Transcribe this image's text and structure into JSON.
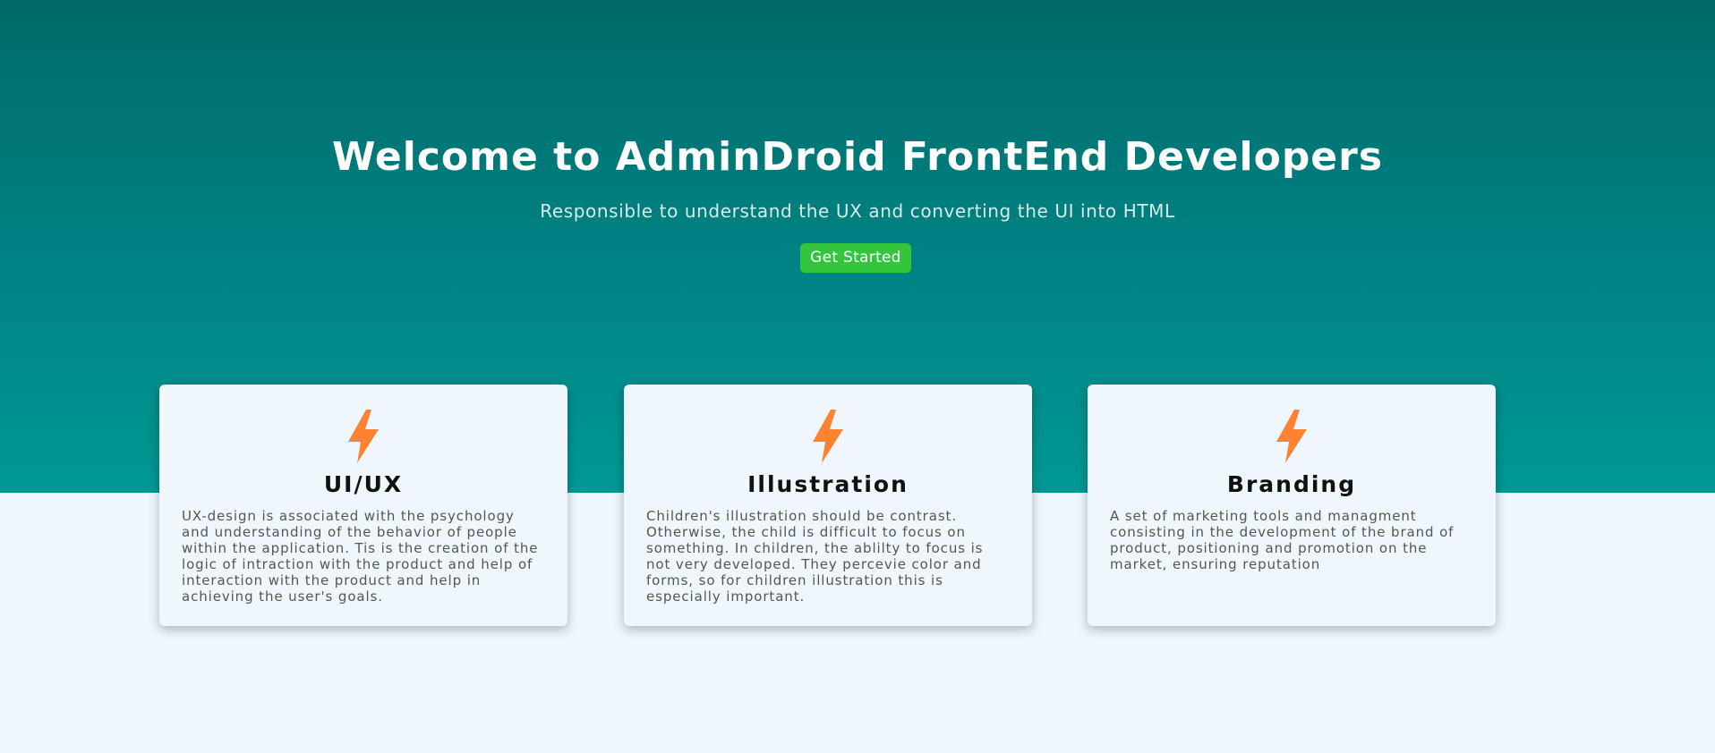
{
  "hero": {
    "title": "Welcome to AdminDroid FrontEnd Developers",
    "subtitle": "Responsible to understand the UX and converting the UI into HTML",
    "cta_label": "Get Started"
  },
  "cards": [
    {
      "icon": "lightning-bolt-icon",
      "title": "UI/UX",
      "text": "UX-design is associated with the psychology and understanding of the behavior of people within the application. Tis is the creation of the logic of intraction with the product and help of interaction with the product and help in achieving the user's goals."
    },
    {
      "icon": "lightning-bolt-icon",
      "title": "Illustration",
      "text": "Children's illustration should be contrast. Otherwise, the child is difficult to focus on something. In children, the ablilty to focus is not very developed. They percevie color and forms, so for children illustration this is especially important."
    },
    {
      "icon": "lightning-bolt-icon",
      "title": "Branding",
      "text": "A set of marketing tools and managment consisting in the development of the brand of product, positioning and promotion on the market, ensuring reputation"
    }
  ],
  "colors": {
    "hero_gradient_top": "#006a68",
    "hero_gradient_bottom": "#009896",
    "page_background": "#eff7fd",
    "cta_button": "#33c63c",
    "icon_accent": "#fd8333"
  }
}
